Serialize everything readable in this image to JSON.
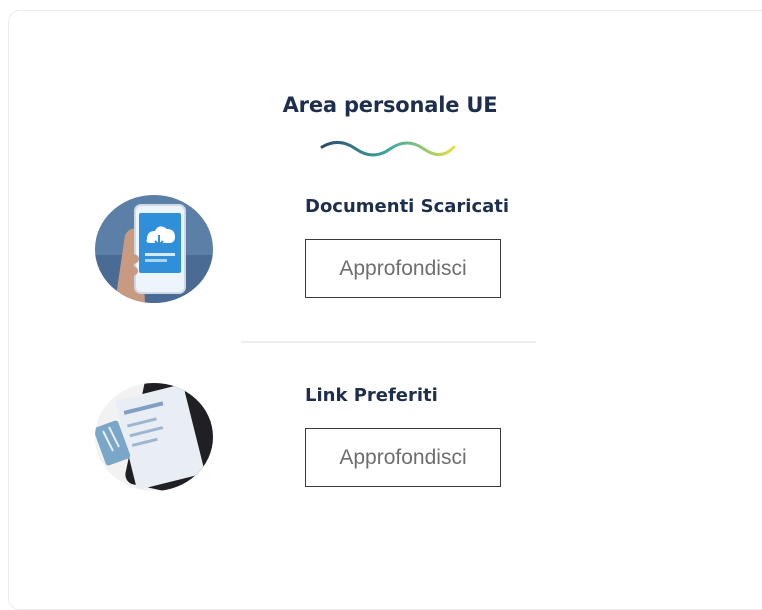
{
  "section": {
    "title": "Area personale UE"
  },
  "items": [
    {
      "title": "Documenti Scaricati",
      "button_label": "Approfondisci",
      "image": "phone-cloud-download-photo"
    },
    {
      "title": "Link Preferiti",
      "button_label": "Approfondisci",
      "image": "tablet-phone-photo"
    }
  ],
  "colors": {
    "title": "#1e2f4d",
    "wave_start": "#2f4a6d",
    "wave_mid": "#3aa8a0",
    "wave_end": "#e6e04a"
  }
}
